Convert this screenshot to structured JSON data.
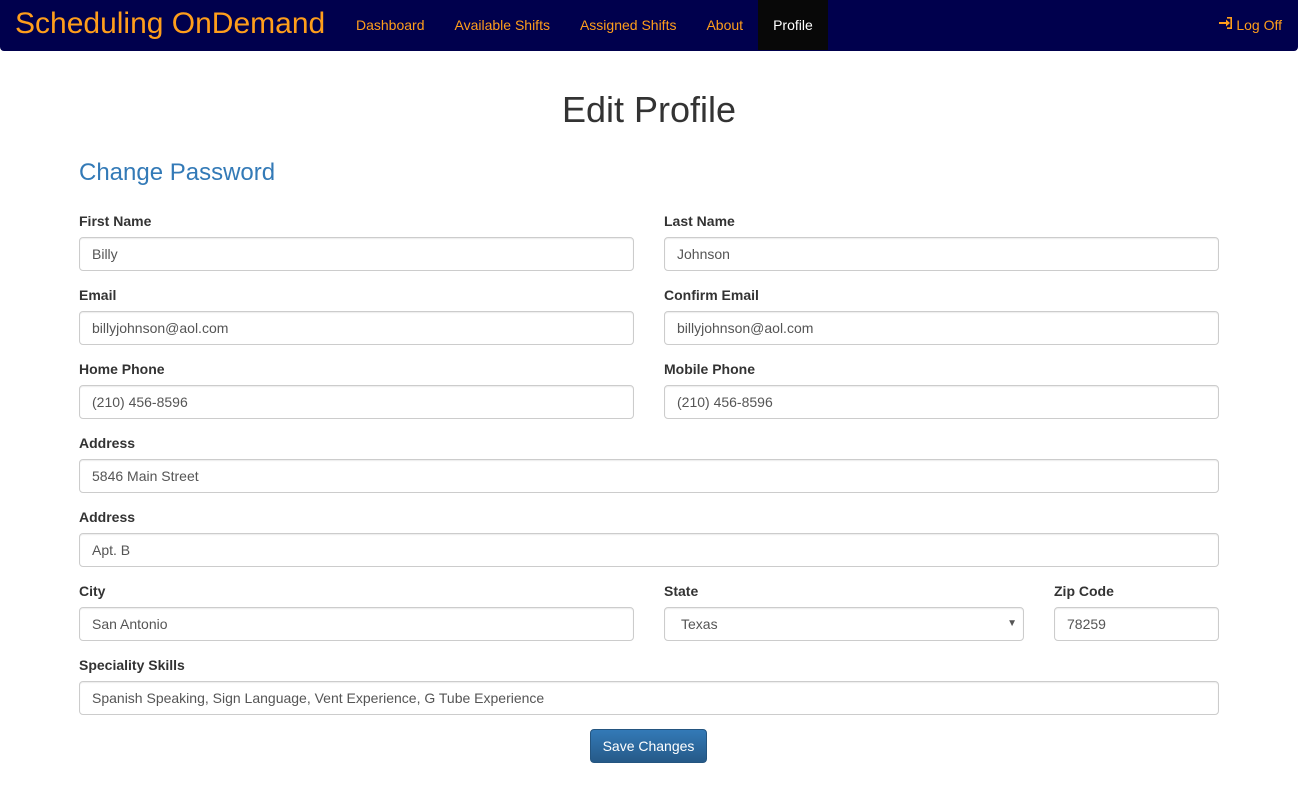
{
  "nav": {
    "brand": "Scheduling OnDemand",
    "items": [
      {
        "label": "Dashboard"
      },
      {
        "label": "Available Shifts"
      },
      {
        "label": "Assigned Shifts"
      },
      {
        "label": "About"
      },
      {
        "label": "Profile",
        "active": true
      }
    ],
    "logoff_label": "Log Off",
    "colors": {
      "bar": "#00004d",
      "link": "#ff9e1b",
      "active_bg": "#080808"
    }
  },
  "page": {
    "title": "Edit Profile",
    "change_password_link": "Change Password"
  },
  "form": {
    "first_name": {
      "label": "First Name",
      "value": "Billy"
    },
    "last_name": {
      "label": "Last Name",
      "value": "Johnson"
    },
    "email": {
      "label": "Email",
      "value": "billyjohnson@aol.com"
    },
    "confirm_email": {
      "label": "Confirm Email",
      "value": "billyjohnson@aol.com"
    },
    "home_phone": {
      "label": "Home Phone",
      "value": "(210) 456-8596"
    },
    "mobile_phone": {
      "label": "Mobile Phone",
      "value": "(210) 456-8596"
    },
    "address1": {
      "label": "Address",
      "value": "5846 Main Street"
    },
    "address2": {
      "label": "Address",
      "value": "Apt. B"
    },
    "city": {
      "label": "City",
      "value": "San Antonio"
    },
    "state": {
      "label": "State",
      "value": "Texas"
    },
    "zip": {
      "label": "Zip Code",
      "value": "78259"
    },
    "skills": {
      "label": "Speciality Skills",
      "value": "Spanish Speaking, Sign Language, Vent Experience, G Tube Experience"
    },
    "save_label": "Save Changes"
  }
}
